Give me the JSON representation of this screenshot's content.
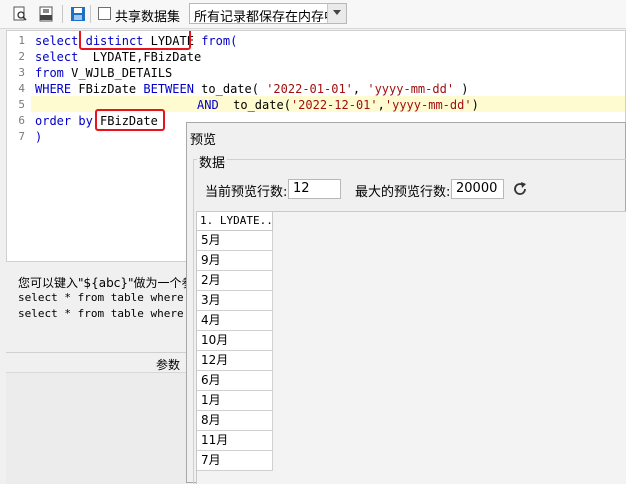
{
  "toolbar": {
    "share_dataset_label": "共享数据集",
    "save_mode_value": "所有记录都保存在内存中",
    "icons": [
      "preview-icon",
      "sql-icon",
      "save-icon"
    ]
  },
  "editor": {
    "line_numbers": [
      "1",
      "2",
      "3",
      "4",
      "5",
      "6",
      "7"
    ],
    "lines": {
      "l1": {
        "kw1": "select",
        "kw2": "distinct",
        "t1": " LYDATE ",
        "kw3": "from("
      },
      "l2": {
        "kw1": "select",
        "t1": "  LYDATE,FBizDate"
      },
      "l3": {
        "kw1": "from",
        "t1": " V_WJLB_DETAILS"
      },
      "l4": {
        "kw1": "WHERE",
        "t1": " FBizDate ",
        "kw2": "BETWEEN",
        "t2": " to_date( ",
        "s1": "'2022-01-01'",
        "t3": ", ",
        "s2": "'yyyy-mm-dd'",
        "t4": " )"
      },
      "l5": {
        "kw1": "AND",
        "t1": "  to_date(",
        "s1": "'2022-12-01'",
        "t2": ",",
        "s2": "'yyyy-mm-dd'",
        "t3": ")"
      },
      "l6": {
        "kw1": "order by",
        "t1": " FBizDate"
      },
      "l7": {
        "t1": ")"
      }
    }
  },
  "hint": {
    "line1": "您可以键入\"${abc}\"做为一个参",
    "line2": "select * from table where id",
    "line3": "select * from table where id"
  },
  "params": {
    "header_label": "参数"
  },
  "preview_dialog": {
    "title": "预览",
    "group_title": "数据",
    "current_rows_label": "当前预览行数:",
    "current_rows_value": "12",
    "max_rows_label": "最大的预览行数:",
    "max_rows_value": "20000",
    "column_header": "1. LYDATE...",
    "rows": [
      "5月",
      "9月",
      "2月",
      "3月",
      "4月",
      "10月",
      "12月",
      "6月",
      "1月",
      "8月",
      "11月",
      "7月"
    ]
  },
  "colors": {
    "keyword": "#0000c8",
    "string": "#a01010",
    "highlight_box": "#e8141c",
    "current_line": "#fffbd0"
  }
}
